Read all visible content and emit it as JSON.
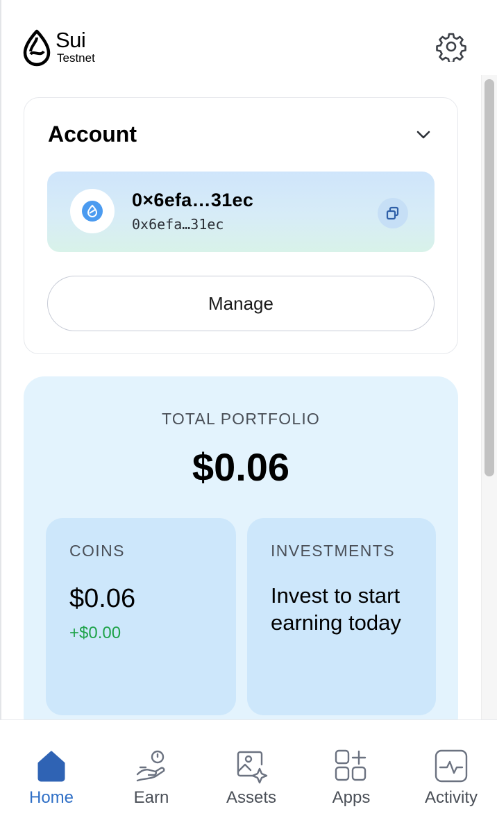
{
  "header": {
    "logo_name": "Sui",
    "network": "Testnet",
    "settings_icon": "gear-icon"
  },
  "account": {
    "title": "Account",
    "collapse_icon": "chevron-down-icon",
    "address_name": "0×6efa…31ec",
    "address_short": "0x6efa…31ec",
    "copy_icon": "copy-icon",
    "manage_label": "Manage"
  },
  "portfolio": {
    "label": "TOTAL PORTFOLIO",
    "value": "$0.06",
    "coins": {
      "label": "COINS",
      "value": "$0.06",
      "change": "+$0.00"
    },
    "investments": {
      "label": "INVESTMENTS",
      "text": "Invest to start earning today"
    }
  },
  "nav": {
    "items": [
      {
        "label": "Home",
        "icon": "home-icon",
        "active": true
      },
      {
        "label": "Earn",
        "icon": "earn-icon",
        "active": false
      },
      {
        "label": "Assets",
        "icon": "assets-icon",
        "active": false
      },
      {
        "label": "Apps",
        "icon": "apps-icon",
        "active": false
      },
      {
        "label": "Activity",
        "icon": "activity-icon",
        "active": false
      }
    ]
  },
  "colors": {
    "accent": "#2f6fc6",
    "positive": "#1fa34a",
    "portfolio_bg": "#e3f3fd",
    "subcard_bg": "#cde7fb"
  }
}
